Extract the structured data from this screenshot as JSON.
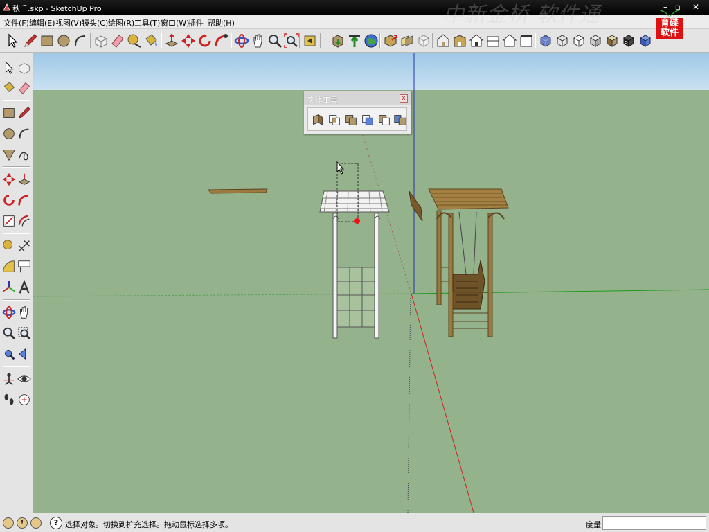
{
  "window": {
    "title": "秋千.skp - SketchUp Pro",
    "watermark": "中新金桥 软件通",
    "logo_text": "育碟软件",
    "controls": {
      "minimize": "–",
      "restore": "▫",
      "close": "✕"
    }
  },
  "menu": {
    "items": [
      "文件(F)",
      "编辑(E)",
      "视图(V)",
      "镜头(C)",
      "绘图(R)",
      "工具(T)",
      "窗口(W)",
      "插件",
      "帮助(H)"
    ]
  },
  "toolbar": {
    "icons": [
      "select-icon",
      "pencil-icon",
      "rectangle-icon",
      "circle-icon",
      "arc-icon",
      "make-component-icon",
      "eraser-icon",
      "tape-measure-icon",
      "paint-bucket-icon",
      "push-pull-icon",
      "move-icon",
      "rotate-icon",
      "follow-me-icon",
      "orbit-icon",
      "pan-icon",
      "zoom-icon",
      "zoom-extents-icon",
      "previous-view-icon",
      "get-models-icon",
      "share-model-icon",
      "google-earth-icon",
      "component-icon",
      "section-icon",
      "iso-view-icon",
      "top-view-icon",
      "front-view-icon",
      "right-view-icon",
      "back-view-icon",
      "left-view-icon",
      "xray-icon",
      "wireframe-icon",
      "hidden-line-icon",
      "shaded-icon",
      "shaded-texture-icon",
      "monochrome-icon"
    ]
  },
  "solid_tools": {
    "title": "实体工具",
    "close": "x",
    "tools": [
      "outer-shell-icon",
      "intersect-icon",
      "union-icon",
      "subtract-icon",
      "trim-icon",
      "split-icon"
    ]
  },
  "status": {
    "icons": [
      "geo-location-icon",
      "credits-icon",
      "user-icon"
    ],
    "help": "?",
    "message": "选择对象。切换到扩充选择。拖动鼠标选择多项。",
    "measure_label": "度量",
    "measure_value": ""
  },
  "colors": {
    "sky_top": "#9ec8e6",
    "ground": "#94b28c",
    "axis_red": "#c22",
    "axis_green": "#1a9a1a",
    "axis_blue": "#2233aa",
    "wood": "#9c7a3e"
  }
}
